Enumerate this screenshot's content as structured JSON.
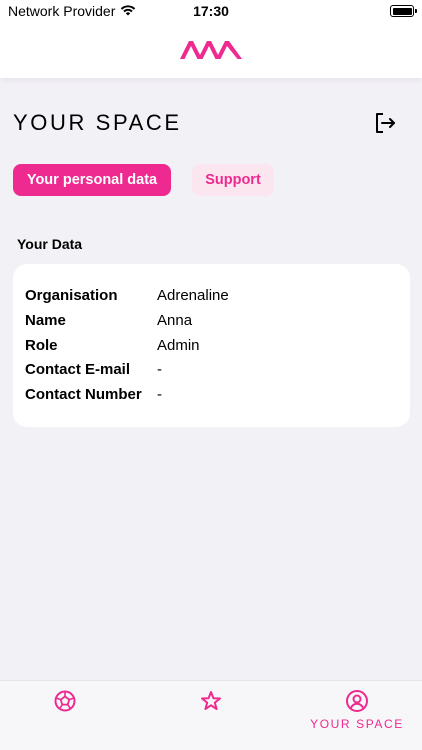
{
  "status_bar": {
    "carrier": "Network Provider",
    "time": "17:30"
  },
  "header": {
    "logo_icon": "aim-logo"
  },
  "page": {
    "title": "YOUR SPACE",
    "logout_icon": "logout-icon"
  },
  "tabs": [
    {
      "label": "Your personal data",
      "active": true
    },
    {
      "label": "Support",
      "active": false
    }
  ],
  "data_section": {
    "title": "Your Data",
    "rows": [
      {
        "label": "Organisation",
        "value": "Adrenaline"
      },
      {
        "label": "Name",
        "value": "Anna"
      },
      {
        "label": "Role",
        "value": "Admin"
      },
      {
        "label": "Contact E-mail",
        "value": "-"
      },
      {
        "label": "Contact Number",
        "value": "-"
      }
    ]
  },
  "tab_bar": {
    "items": [
      {
        "icon": "ball-icon",
        "label": ""
      },
      {
        "icon": "star-icon",
        "label": ""
      },
      {
        "icon": "user-circle-icon",
        "label": "YOUR SPACE",
        "active": true
      }
    ]
  },
  "colors": {
    "accent": "#ee2a90",
    "accent_light": "#fbe6f0",
    "background": "#f2f1f6",
    "card": "#ffffff"
  }
}
